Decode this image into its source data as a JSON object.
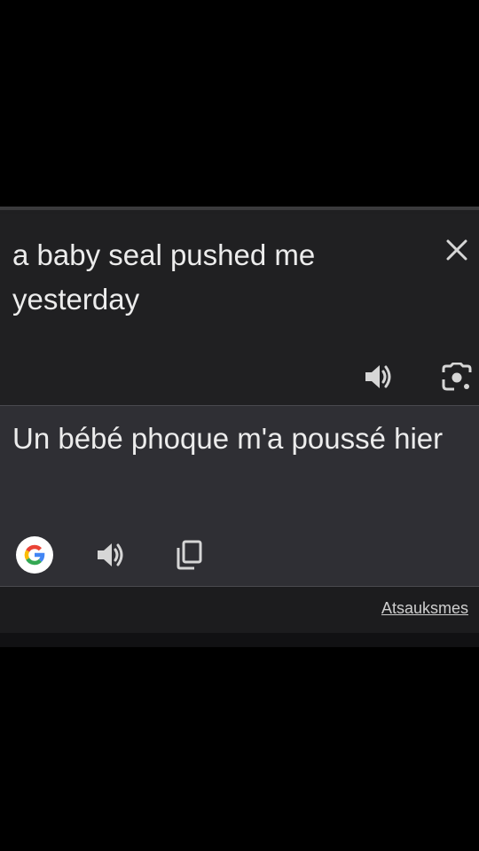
{
  "source": {
    "text": "a baby seal pushed me yesterday",
    "icons": [
      "close-icon",
      "speaker-icon",
      "lens-icon"
    ]
  },
  "target": {
    "text": "Un bébé phoque m'a poussé hier",
    "icons": [
      "google-icon",
      "speaker-icon",
      "copy-icon"
    ]
  },
  "footer": {
    "feedback_label": "Atsauksmes"
  },
  "colors": {
    "background": "#000000",
    "source_panel": "#202022",
    "target_panel": "#2f2f34",
    "text": "#ececec",
    "icon": "#d6d6d6"
  }
}
